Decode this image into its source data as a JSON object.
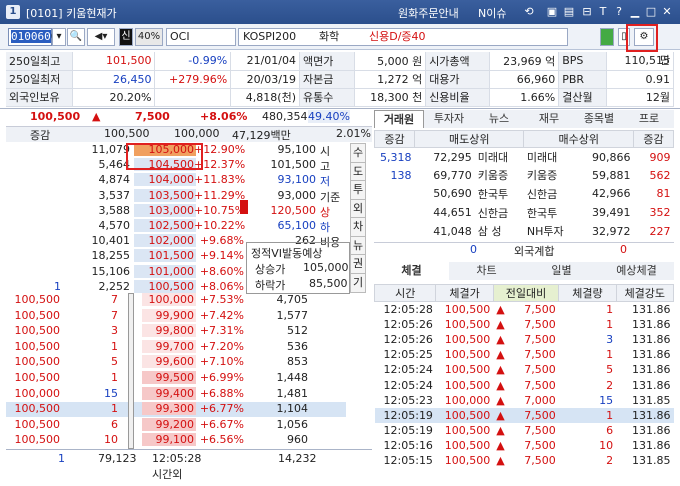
{
  "title": {
    "num": "1",
    "text": "[0101] 키움현재가",
    "menu1": "원화주문안내",
    "menu2": "N이슈",
    "help": "?"
  },
  "toolbar": {
    "code_sel": "010060",
    "code_rest": "0",
    "credit": "신",
    "margin": "40%",
    "name": "OCI",
    "index": "KOSPI200",
    "sector": "화학",
    "credit_info": "신용D/증40",
    "last": "단"
  },
  "info": {
    "rows": [
      [
        "250일최고",
        "101,500",
        "-0.99%",
        "21/01/04",
        "액면가",
        "5,000 원",
        "시가총액",
        "23,969 억",
        "BPS",
        "110,515"
      ],
      [
        "250일최저",
        "26,450",
        "+279.96%",
        "20/03/19",
        "자본금",
        "1,272 억",
        "대용가",
        "66,960",
        "PBR",
        "0.91"
      ],
      [
        "외국인보유",
        "20.20%",
        "",
        "4,818(천)",
        "유통수",
        "18,300 천",
        "신용비율",
        "1.66%",
        "결산월",
        "12월"
      ]
    ]
  },
  "price": {
    "current": "100,500",
    "arrow": "▲",
    "change": "7,500",
    "rate": "+8.06%",
    "volume": "480,354",
    "vol_rate": "49.40%"
  },
  "header2": {
    "label": "증감",
    "p1": "100,500",
    "p2": "100,000",
    "amt": "47,129백만",
    "pct": "2.01%"
  },
  "asks": [
    {
      "qty": "11,079",
      "price": "105,000",
      "pct": "+12.90%"
    },
    {
      "qty": "5,464",
      "price": "104,500",
      "pct": "+12.37%"
    },
    {
      "qty": "4,874",
      "price": "104,000",
      "pct": "+11.83%"
    },
    {
      "qty": "3,537",
      "price": "103,500",
      "pct": "+11.29%"
    },
    {
      "qty": "3,588",
      "price": "103,000",
      "pct": "+10.75%"
    },
    {
      "qty": "4,570",
      "price": "102,500",
      "pct": "+10.22%"
    },
    {
      "qty": "10,401",
      "price": "102,000",
      "pct": "+9.68%"
    },
    {
      "qty": "18,255",
      "price": "101,500",
      "pct": "+9.14%"
    },
    {
      "qty": "15,106",
      "price": "101,000",
      "pct": "+8.60%"
    },
    {
      "qty": "2,252",
      "price": "100,500",
      "pct": "+8.06%",
      "left": "1"
    }
  ],
  "quote_info": [
    {
      "v": "95,100",
      "k": "시"
    },
    {
      "v": "101,500",
      "k": "고"
    },
    {
      "v": "93,100",
      "k": "저"
    },
    {
      "v": "93,000",
      "k": "기준"
    },
    {
      "v": "120,500",
      "k": "상"
    },
    {
      "v": "65,100",
      "k": "하"
    },
    {
      "v": "262",
      "k": "비용"
    }
  ],
  "vi": {
    "title": "정적VI발동예상",
    "up_l": "상승가",
    "up_v": "105,000",
    "dn_l": "하락가",
    "dn_v": "85,500"
  },
  "vtabs": [
    "수",
    "도",
    "투",
    "외",
    "차",
    "뉴",
    "권",
    "기"
  ],
  "bids": [
    {
      "l1": "100,500",
      "l2": "7",
      "price": "100,000",
      "pct": "+7.53%",
      "qty": "4,705"
    },
    {
      "l1": "100,500",
      "l2": "7",
      "price": "99,900",
      "pct": "+7.42%",
      "qty": "1,577"
    },
    {
      "l1": "100,500",
      "l2": "3",
      "price": "99,800",
      "pct": "+7.31%",
      "qty": "512"
    },
    {
      "l1": "100,500",
      "l2": "1",
      "price": "99,700",
      "pct": "+7.20%",
      "qty": "536"
    },
    {
      "l1": "100,500",
      "l2": "5",
      "price": "99,600",
      "pct": "+7.10%",
      "qty": "853"
    },
    {
      "l1": "100,500",
      "l2": "1",
      "price": "99,500",
      "pct": "+6.99%",
      "qty": "1,448"
    },
    {
      "l1": "100,000",
      "l2": "15",
      "price": "99,400",
      "pct": "+6.88%",
      "qty": "1,481"
    },
    {
      "l1": "100,500",
      "l2": "1",
      "price": "99,300",
      "pct": "+6.77%",
      "qty": "1,104"
    },
    {
      "l1": "100,500",
      "l2": "6",
      "price": "99,200",
      "pct": "+6.67%",
      "qty": "1,056"
    },
    {
      "l1": "100,500",
      "l2": "10",
      "price": "99,100",
      "pct": "+6.56%",
      "qty": "960"
    }
  ],
  "footer": {
    "left": "1",
    "ask_total": "79,123",
    "time": "12:05:28",
    "bid_total": "14,232",
    "after": "시간외"
  },
  "rtabs": [
    "거래원",
    "투자자",
    "뉴스",
    "재무",
    "종목별",
    "프로"
  ],
  "broker": {
    "hdr": [
      "증감",
      "매도상위",
      "매수상위",
      "증감"
    ],
    "rows": [
      [
        "5,318",
        "72,295",
        "미래대",
        "미래대",
        "90,866",
        "909"
      ],
      [
        "138",
        "69,770",
        "키움증",
        "키움증",
        "59,881",
        "562"
      ],
      [
        "",
        "50,690",
        "한국투",
        "신한금",
        "42,966",
        "81"
      ],
      [
        "",
        "44,651",
        "신한금",
        "한국투",
        "39,491",
        "352"
      ],
      [
        "",
        "41,048",
        "삼 성",
        "NH투자",
        "32,972",
        "227"
      ]
    ],
    "foreign": {
      "l": "0",
      "label": "외국계합",
      "r": "0"
    }
  },
  "ttabs": [
    "체결",
    "차트",
    "일별",
    "예상체결"
  ],
  "trades": {
    "hdr": [
      "시간",
      "체결가",
      "전일대비",
      "체결량",
      "체결강도"
    ],
    "rows": [
      [
        "12:05:28",
        "100,500",
        "7,500",
        "1",
        "131.86",
        "r"
      ],
      [
        "12:05:26",
        "100,500",
        "7,500",
        "1",
        "131.86",
        "r"
      ],
      [
        "12:05:26",
        "100,500",
        "7,500",
        "3",
        "131.86",
        "b"
      ],
      [
        "12:05:25",
        "100,500",
        "7,500",
        "1",
        "131.86",
        "r"
      ],
      [
        "12:05:24",
        "100,500",
        "7,500",
        "5",
        "131.86",
        "r"
      ],
      [
        "12:05:24",
        "100,500",
        "7,500",
        "2",
        "131.86",
        "r"
      ],
      [
        "12:05:23",
        "100,000",
        "7,000",
        "15",
        "131.85",
        "b"
      ],
      [
        "12:05:19",
        "100,500",
        "7,500",
        "1",
        "131.86",
        "r"
      ],
      [
        "12:05:19",
        "100,500",
        "7,500",
        "6",
        "131.86",
        "r"
      ],
      [
        "12:05:16",
        "100,500",
        "7,500",
        "10",
        "131.86",
        "r"
      ],
      [
        "12:05:15",
        "100,500",
        "7,500",
        "2",
        "131.85",
        "r"
      ]
    ]
  }
}
